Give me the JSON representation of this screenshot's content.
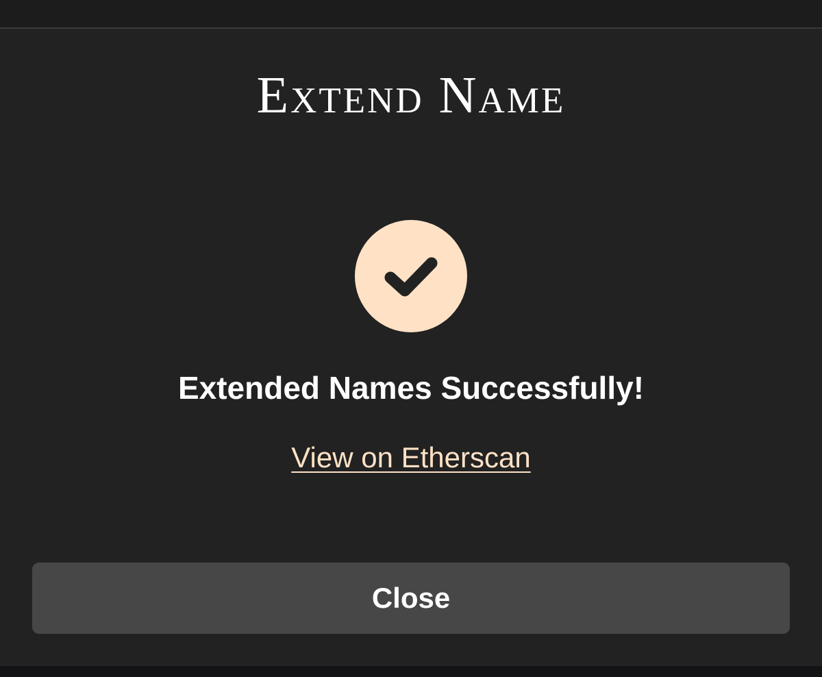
{
  "modal": {
    "title": "Extend Name",
    "success_icon": "checkmark-icon",
    "success_message": "Extended Names Successfully!",
    "etherscan_link_label": "View on Etherscan",
    "close_label": "Close"
  },
  "colors": {
    "accent": "#ffe2c6",
    "background": "#222222",
    "button": "#474747",
    "text": "#ffffff"
  }
}
